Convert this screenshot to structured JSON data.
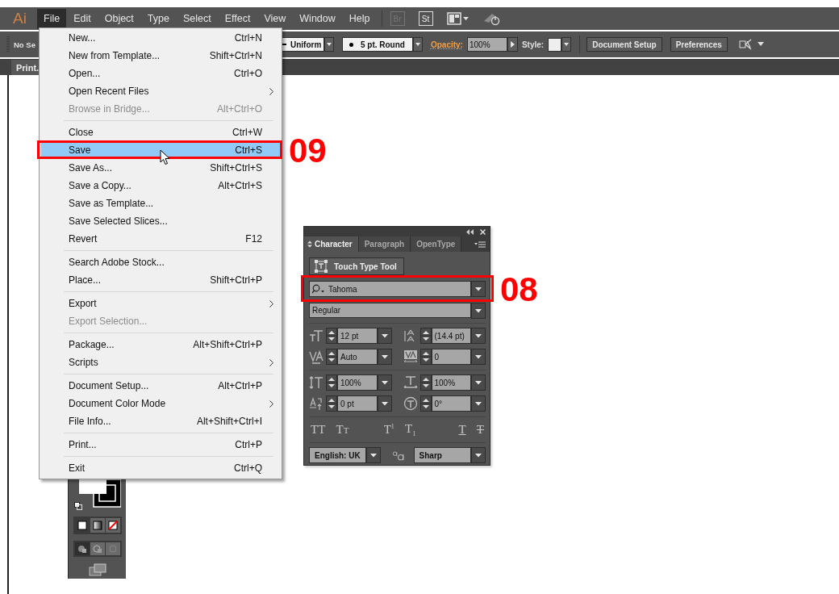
{
  "app": {
    "logo": "Ai"
  },
  "menubar": {
    "items": [
      {
        "label": "File",
        "selected": true
      },
      {
        "label": "Edit",
        "selected": false
      },
      {
        "label": "Object",
        "selected": false
      },
      {
        "label": "Type",
        "selected": false
      },
      {
        "label": "Select",
        "selected": false
      },
      {
        "label": "Effect",
        "selected": false
      },
      {
        "label": "View",
        "selected": false
      },
      {
        "label": "Window",
        "selected": false
      },
      {
        "label": "Help",
        "selected": false
      }
    ],
    "bridge_button": "Br",
    "stock_button": "St"
  },
  "control_bar": {
    "selection": "No Se",
    "stroke_profile": "Uniform",
    "brush": "5 pt. Round",
    "opacity_label": "Opacity:",
    "opacity": "100%",
    "style_label": "Style:",
    "buttons": [
      "Document Setup",
      "Preferences"
    ]
  },
  "document_tab": {
    "title": "Print."
  },
  "file_menu": {
    "items": [
      {
        "kind": "item",
        "label": "New...",
        "shortcut": "Ctrl+N",
        "disabled": false,
        "submenu": false,
        "selected": false
      },
      {
        "kind": "item",
        "label": "New from Template...",
        "shortcut": "Shift+Ctrl+N",
        "disabled": false,
        "submenu": false,
        "selected": false
      },
      {
        "kind": "item",
        "label": "Open...",
        "shortcut": "Ctrl+O",
        "disabled": false,
        "submenu": false,
        "selected": false
      },
      {
        "kind": "item",
        "label": "Open Recent Files",
        "disabled": false,
        "submenu": true,
        "selected": false
      },
      {
        "kind": "item",
        "label": "Browse in Bridge...",
        "shortcut": "Alt+Ctrl+O",
        "disabled": true,
        "submenu": false,
        "selected": false
      },
      {
        "kind": "separator"
      },
      {
        "kind": "item",
        "label": "Close",
        "shortcut": "Ctrl+W",
        "disabled": false,
        "submenu": false,
        "selected": false
      },
      {
        "kind": "item",
        "label": "Save",
        "shortcut": "Ctrl+S",
        "disabled": false,
        "submenu": false,
        "selected": true
      },
      {
        "kind": "item",
        "label": "Save As...",
        "shortcut": "Shift+Ctrl+S",
        "disabled": false,
        "submenu": false,
        "selected": false
      },
      {
        "kind": "item",
        "label": "Save a Copy...",
        "shortcut": "Alt+Ctrl+S",
        "disabled": false,
        "submenu": false,
        "selected": false
      },
      {
        "kind": "item",
        "label": "Save as Template...",
        "disabled": false,
        "submenu": false,
        "selected": false
      },
      {
        "kind": "item",
        "label": "Save Selected Slices...",
        "disabled": false,
        "submenu": false,
        "selected": false
      },
      {
        "kind": "item",
        "label": "Revert",
        "shortcut": "F12",
        "disabled": false,
        "submenu": false,
        "selected": false
      },
      {
        "kind": "separator"
      },
      {
        "kind": "item",
        "label": "Search Adobe Stock...",
        "disabled": false,
        "submenu": false,
        "selected": false
      },
      {
        "kind": "item",
        "label": "Place...",
        "shortcut": "Shift+Ctrl+P",
        "disabled": false,
        "submenu": false,
        "selected": false
      },
      {
        "kind": "separator"
      },
      {
        "kind": "item",
        "label": "Export",
        "disabled": false,
        "submenu": true,
        "selected": false
      },
      {
        "kind": "item",
        "label": "Export Selection...",
        "disabled": true,
        "submenu": false,
        "selected": false
      },
      {
        "kind": "separator"
      },
      {
        "kind": "item",
        "label": "Package...",
        "shortcut": "Alt+Shift+Ctrl+P",
        "disabled": false,
        "submenu": false,
        "selected": false
      },
      {
        "kind": "item",
        "label": "Scripts",
        "disabled": false,
        "submenu": true,
        "selected": false
      },
      {
        "kind": "separator"
      },
      {
        "kind": "item",
        "label": "Document Setup...",
        "shortcut": "Alt+Ctrl+P",
        "disabled": false,
        "submenu": false,
        "selected": false
      },
      {
        "kind": "item",
        "label": "Document Color Mode",
        "disabled": false,
        "submenu": true,
        "selected": false
      },
      {
        "kind": "item",
        "label": "File Info...",
        "shortcut": "Alt+Shift+Ctrl+I",
        "disabled": false,
        "submenu": false,
        "selected": false
      },
      {
        "kind": "separator"
      },
      {
        "kind": "item",
        "label": "Print...",
        "shortcut": "Ctrl+P",
        "disabled": false,
        "submenu": false,
        "selected": false
      },
      {
        "kind": "separator"
      },
      {
        "kind": "item",
        "label": "Exit",
        "shortcut": "Ctrl+Q",
        "disabled": false,
        "submenu": false,
        "selected": false
      }
    ]
  },
  "character_panel": {
    "tabs": [
      {
        "label": "Character",
        "selected": true
      },
      {
        "label": "Paragraph",
        "selected": false
      },
      {
        "label": "OpenType",
        "selected": false
      }
    ],
    "touch_type_button": "Touch Type Tool",
    "font_family": "Tahoma",
    "font_style": "Regular",
    "metrics": [
      {
        "kind": "font_size",
        "value": "12 pt"
      },
      {
        "kind": "leading",
        "value": "(14.4 pt)"
      },
      {
        "kind": "kerning",
        "value": "Auto"
      },
      {
        "kind": "tracking",
        "value": "0"
      },
      {
        "kind": "vertical_scale",
        "value": "100%"
      },
      {
        "kind": "horizontal_scale",
        "value": "100%"
      },
      {
        "kind": "baseline_shift",
        "value": "0 pt"
      },
      {
        "kind": "rotation",
        "value": "0°"
      }
    ],
    "type_buttons": [
      {
        "kind": "all_caps",
        "label": "TT"
      },
      {
        "kind": "small_caps",
        "label": "Tt"
      },
      {
        "kind": "superscript",
        "label": "T$^{1}$"
      },
      {
        "kind": "subscript",
        "label": "T$_{1}$"
      },
      {
        "kind": "underline",
        "label": "T"
      },
      {
        "kind": "strikethrough",
        "label": "T"
      }
    ],
    "language": "English: UK",
    "antialiasing": "Sharp"
  },
  "annotations": [
    {
      "kind": "menu_item",
      "label": "09"
    },
    {
      "kind": "panel_field",
      "label": "08"
    }
  ]
}
